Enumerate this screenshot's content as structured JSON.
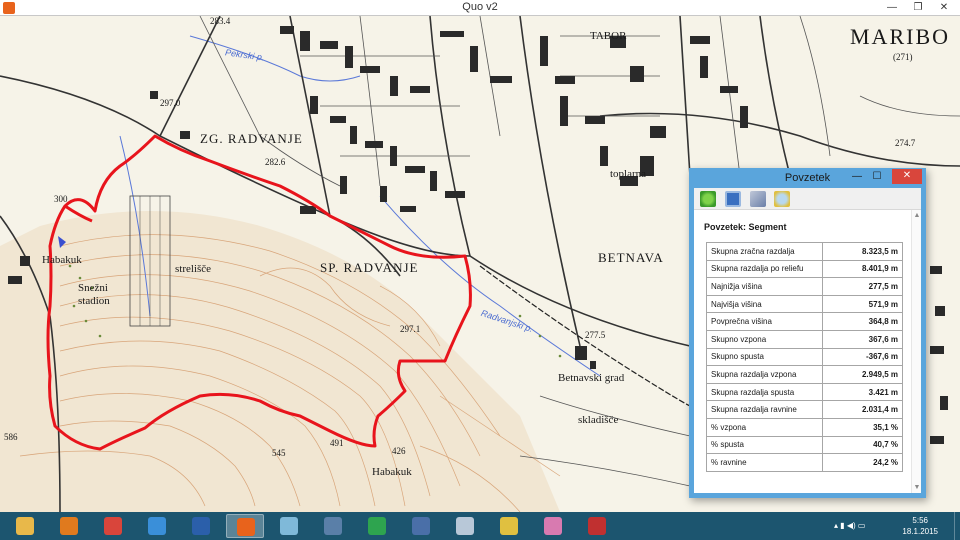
{
  "window": {
    "title": "Quo v2",
    "minimize_glyph": "—",
    "restore_glyph": "❐",
    "close_glyph": "✕"
  },
  "map": {
    "labels": {
      "zg_radvanje": "ZG. RADVANJE",
      "sp_radvanje": "SP. RADVANJE",
      "betnava": "BETNAVA",
      "tabor": "TABOR",
      "maribor": "MARIBO",
      "maribor_elev": "(271)",
      "habakuk_left": "Habakuk",
      "habakuk_bottom": "Habakuk",
      "snezni": "Snežni",
      "stadion": "stadion",
      "strelisce": "strelišče",
      "toplarna": "toplarna",
      "betnavski_grad": "Betnavski grad",
      "skladisce": "skladišče",
      "pekrski": "Pekrski p.",
      "radvanjski": "Radvanjski p.",
      "elev_2834": "283.4",
      "elev_2970": "297.0",
      "elev_2826": "282.6",
      "elev_2747": "274.7",
      "elev_2971": "297.1",
      "elev_2775": "277.5",
      "elev_2775b": "277.5",
      "elev_491": "491",
      "elev_545": "545",
      "elev_426": "426",
      "elev_586": "586",
      "elev_300": "300"
    },
    "route_color": "#e8141c"
  },
  "dialog": {
    "title": "Povzetek",
    "heading": "Povzetek: Segment",
    "minimize_glyph": "—",
    "restore_glyph": "☐",
    "close_glyph": "✕",
    "toolbar_icons": [
      "refresh-icon",
      "save-icon",
      "export-icon",
      "zoom-icon"
    ],
    "stats": [
      {
        "label": "Skupna zračna razdalja",
        "value": "8.323,5 m"
      },
      {
        "label": "Skupna razdalja po reliefu",
        "value": "8.401,9 m"
      },
      {
        "label": "Najnižja višina",
        "value": "277,5 m"
      },
      {
        "label": "Najvišja višina",
        "value": "571,9 m"
      },
      {
        "label": "Povprečna višina",
        "value": "364,8 m"
      },
      {
        "label": "Skupno vzpona",
        "value": "367,6 m"
      },
      {
        "label": "Skupno spusta",
        "value": "-367,6 m"
      },
      {
        "label": "Skupna razdalja vzpona",
        "value": "2.949,5 m"
      },
      {
        "label": "Skupna razdalja spusta",
        "value": "3.421 m"
      },
      {
        "label": "Skupna razdalja ravnine",
        "value": "2.031,4 m"
      },
      {
        "label": "% vzpona",
        "value": "35,1 %"
      },
      {
        "label": "% spusta",
        "value": "40,7 %"
      },
      {
        "label": "% ravnine",
        "value": "24,2 %"
      }
    ]
  },
  "taskbar": {
    "apps": [
      {
        "name": "file-explorer-icon",
        "color": "#e8b84a"
      },
      {
        "name": "outlook-icon",
        "color": "#e07a1e"
      },
      {
        "name": "chrome-icon",
        "color": "#d9453b"
      },
      {
        "name": "internet-explorer-icon",
        "color": "#3a8fd9"
      },
      {
        "name": "word-icon",
        "color": "#2b5faa"
      },
      {
        "name": "quo-icon",
        "color": "#e8631c"
      },
      {
        "name": "app-icon-7",
        "color": "#7fb9d9"
      },
      {
        "name": "calculator-icon",
        "color": "#5a7fa8"
      },
      {
        "name": "google-drive-icon",
        "color": "#2ea44f"
      },
      {
        "name": "app-icon-10",
        "color": "#4a6fa8"
      },
      {
        "name": "app-icon-11",
        "color": "#b8c8d8"
      },
      {
        "name": "app-icon-12",
        "color": "#e0c040"
      },
      {
        "name": "app-icon-13",
        "color": "#d87ab0"
      },
      {
        "name": "app-icon-14",
        "color": "#c03030"
      }
    ],
    "time": "5:56",
    "date": "18.1.2015",
    "tray_glyphs": "▴ ▮ ◀) ▭"
  }
}
